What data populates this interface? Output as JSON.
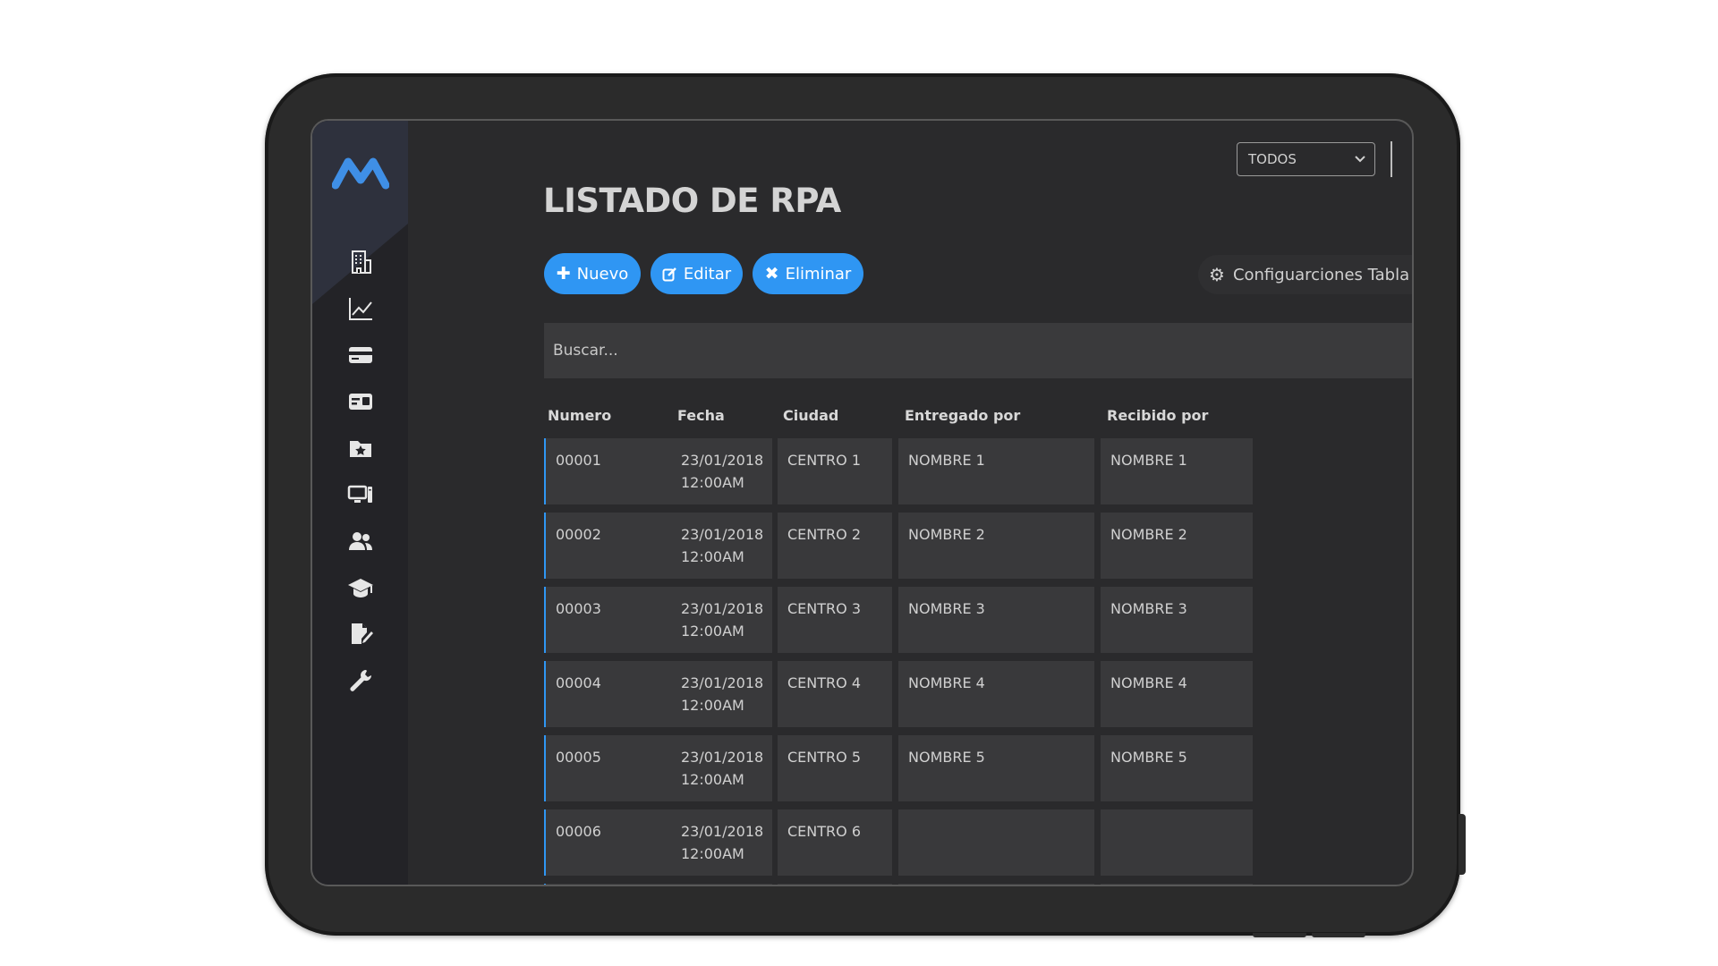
{
  "page": {
    "title": "LISTADO DE RPA",
    "filter": {
      "selected": "TODOS"
    },
    "actions": {
      "new": "Nuevo",
      "edit": "Editar",
      "delete": "Eliminar"
    },
    "config_label": "Configuarciones Tabla",
    "search_placeholder": "Buscar..."
  },
  "sidebar": {
    "items": [
      {
        "icon": "building-icon"
      },
      {
        "icon": "chart-line-icon"
      },
      {
        "icon": "credit-card-icon"
      },
      {
        "icon": "id-card-icon"
      },
      {
        "icon": "folder-star-icon"
      },
      {
        "icon": "desktop-computer-icon"
      },
      {
        "icon": "users-icon"
      },
      {
        "icon": "graduation-cap-icon"
      },
      {
        "icon": "file-signature-icon"
      },
      {
        "icon": "wrench-icon"
      }
    ]
  },
  "table": {
    "headers": [
      "Numero",
      "Fecha",
      "Ciudad",
      "Entregado por",
      "Recibido por"
    ],
    "rows": [
      {
        "numero": "00001",
        "fecha": "23/01/2018",
        "hora": "12:00AM",
        "ciudad": "CENTRO 1",
        "entregado": "NOMBRE 1",
        "recibido": "NOMBRE 1"
      },
      {
        "numero": "00002",
        "fecha": "23/01/2018",
        "hora": "12:00AM",
        "ciudad": "CENTRO 2",
        "entregado": "NOMBRE 2",
        "recibido": "NOMBRE 2"
      },
      {
        "numero": "00003",
        "fecha": "23/01/2018",
        "hora": "12:00AM",
        "ciudad": "CENTRO 3",
        "entregado": "NOMBRE 3",
        "recibido": "NOMBRE 3"
      },
      {
        "numero": "00004",
        "fecha": "23/01/2018",
        "hora": "12:00AM",
        "ciudad": "CENTRO 4",
        "entregado": "NOMBRE 4",
        "recibido": "NOMBRE 4"
      },
      {
        "numero": "00005",
        "fecha": "23/01/2018",
        "hora": "12:00AM",
        "ciudad": "CENTRO 5",
        "entregado": "NOMBRE 5",
        "recibido": "NOMBRE 5"
      },
      {
        "numero": "00006",
        "fecha": "23/01/2018",
        "hora": "12:00AM",
        "ciudad": "CENTRO 6",
        "entregado": "",
        "recibido": ""
      }
    ]
  },
  "colors": {
    "accent": "#2f96f3",
    "background": "#2a2a2c",
    "sidebar": "#232327",
    "cell": "#39393b"
  }
}
